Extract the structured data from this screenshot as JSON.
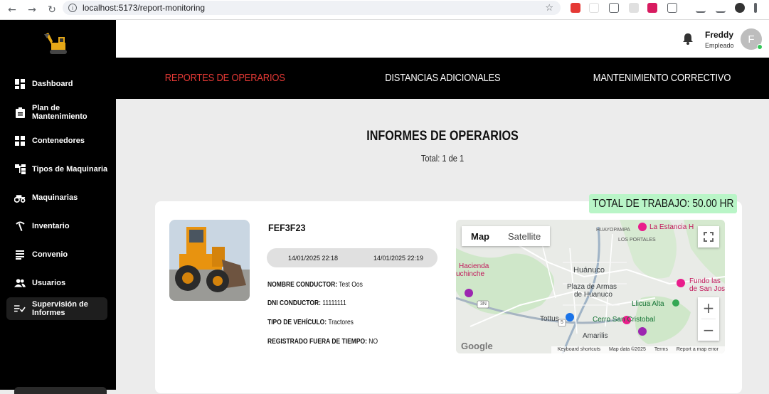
{
  "browser": {
    "url": "localhost:5173/report-monitoring"
  },
  "sidebar": {
    "items": [
      {
        "label": "Dashboard",
        "icon": "dashboard-icon"
      },
      {
        "label": "Plan de Mantenimiento",
        "icon": "clipboard-icon"
      },
      {
        "label": "Contenedores",
        "icon": "grid-icon"
      },
      {
        "label": "Tipos de Maquinaria",
        "icon": "hierarchy-icon"
      },
      {
        "label": "Maquinarias",
        "icon": "tractor-icon"
      },
      {
        "label": "Inventario",
        "icon": "pickaxe-icon"
      },
      {
        "label": "Convenio",
        "icon": "document-icon"
      },
      {
        "label": "Usuarios",
        "icon": "users-icon"
      },
      {
        "label": "Supervisión de Informes",
        "icon": "checklist-icon"
      }
    ]
  },
  "header": {
    "user_name": "Freddy",
    "user_role": "Empleado",
    "avatar_letter": "F"
  },
  "tabs": [
    {
      "label": "REPORTES DE OPERARIOS",
      "active": true
    },
    {
      "label": "DISTANCIAS ADICIONALES",
      "active": false
    },
    {
      "label": "MANTENIMIENTO CORRECTIVO",
      "active": false
    }
  ],
  "main": {
    "title": "INFORMES DE OPERARIOS",
    "total": "Total: 1 de 1"
  },
  "report": {
    "total_work": "TOTAL DE TRABAJO: 50.00 HR",
    "plate": "FEF3F23",
    "start_date": "14/01/2025 22:18",
    "end_date": "14/01/2025 22:19",
    "driver_label": "NOMBRE CONDUCTOR:",
    "driver_value": "Test Oos",
    "dni_label": "DNI CONDUCTOR:",
    "dni_value": "11111111",
    "vehicle_label": "TIPO DE VEHÍCULO:",
    "vehicle_value": "Tractores",
    "offtime_label": "REGISTRADO FUERA DE TIEMPO:",
    "offtime_value": "NO"
  },
  "map": {
    "map_label": "Map",
    "satellite_label": "Satellite",
    "google": "Google",
    "footer": [
      "Keyboard shortcuts",
      "Map data ©2025",
      "Terms",
      "Report a map error"
    ],
    "places": {
      "huayopampa": "HUAYOPAMPA",
      "estancia": "La Estancia H",
      "portales": "LOS PORTALES",
      "hacienda1": "Hacienda",
      "hacienda2": "uchinche",
      "huanuco": "Huánuco",
      "fundo1": "Fundo las",
      "fundo2": "de San Jos",
      "plaza1": "Plaza de Armas",
      "plaza2": "de Huanuco",
      "llicua": "Llicua Alta",
      "tottus": "Tottus",
      "cerro": "Cerro San Cristobal",
      "amarilis": "Amarilis",
      "road3n": "3N",
      "road5": "5"
    }
  },
  "colors": {
    "active_tab": "#e53935",
    "badge": "#b9f5c7"
  }
}
